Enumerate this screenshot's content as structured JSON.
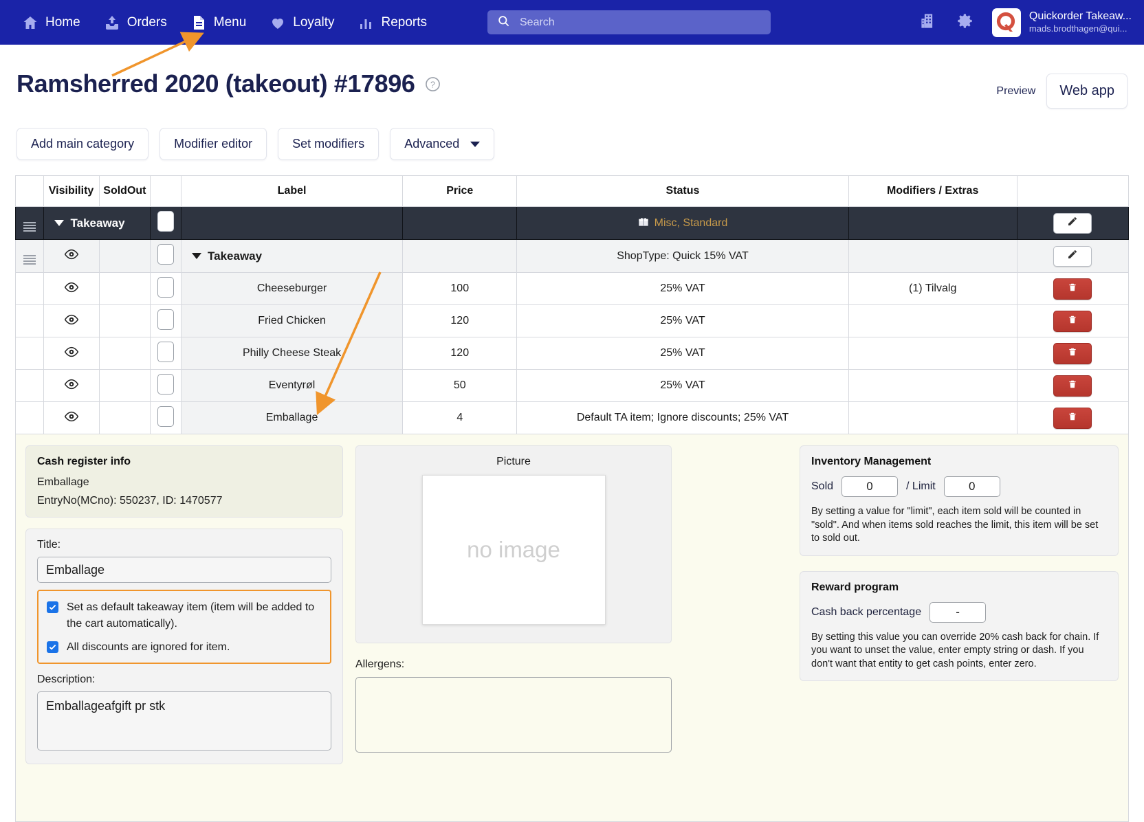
{
  "navbar": {
    "items": [
      {
        "label": "Home",
        "icon": "home-icon"
      },
      {
        "label": "Orders",
        "icon": "orders-icon"
      },
      {
        "label": "Menu",
        "icon": "menu-document-icon"
      },
      {
        "label": "Loyalty",
        "icon": "heart-icon"
      },
      {
        "label": "Reports",
        "icon": "bar-chart-icon"
      }
    ],
    "search": {
      "placeholder": "Search",
      "value": ""
    },
    "building_icon": "building-icon",
    "gear_icon": "gear-icon",
    "brand": {
      "logo_letter": "Q",
      "name": "Quickorder Takeaw...",
      "email": "mads.brodthagen@qui..."
    }
  },
  "header": {
    "title": "Ramsherred 2020 (takeout) #17896",
    "help_icon": "help-circle-icon",
    "preview_label": "Preview",
    "webapp_button": "Web app"
  },
  "toolbar": {
    "add_main_category": "Add main category",
    "modifier_editor": "Modifier editor",
    "set_modifiers": "Set modifiers",
    "advanced": "Advanced"
  },
  "table": {
    "columns": [
      "",
      "Visibility",
      "SoldOut",
      "",
      "Label",
      "Price",
      "Status",
      "Modifiers / Extras",
      ""
    ],
    "category_row": {
      "name": "Takeaway",
      "status": "Misc, Standard",
      "status_icon": "gift-icon",
      "action_icon": "pencil-icon"
    },
    "sub_row": {
      "name": "Takeaway",
      "status": "ShopType: Quick 15% VAT",
      "action_icon": "pencil-icon"
    },
    "items": [
      {
        "label": "Cheeseburger",
        "price": "100",
        "status": "25% VAT",
        "modifiers": "(1) Tilvalg"
      },
      {
        "label": "Fried Chicken",
        "price": "120",
        "status": "25% VAT",
        "modifiers": ""
      },
      {
        "label": "Philly Cheese Steak",
        "price": "120",
        "status": "25% VAT",
        "modifiers": ""
      },
      {
        "label": "Eventyrøl",
        "price": "50",
        "status": "25% VAT",
        "modifiers": ""
      },
      {
        "label": "Emballage",
        "price": "4",
        "status": "Default TA item; Ignore discounts; 25% VAT",
        "modifiers": ""
      }
    ],
    "delete_icon": "trash-icon"
  },
  "detail": {
    "cash_register": {
      "title": "Cash register info",
      "name": "Emballage",
      "entry": "EntryNo(MCno): 550237, ID: 1470577"
    },
    "title_field": {
      "label": "Title:",
      "value": "Emballage"
    },
    "checkboxes": [
      {
        "label": "Set as default takeaway item (item will be added to the cart automatically).",
        "checked": true
      },
      {
        "label": "All discounts are ignored for item.",
        "checked": true
      }
    ],
    "description_field": {
      "label": "Description:",
      "value": "Emballageafgift pr stk"
    },
    "picture": {
      "title": "Picture",
      "placeholder": "no image"
    },
    "allergens": {
      "label": "Allergens:",
      "value": ""
    },
    "inventory": {
      "title": "Inventory Management",
      "sold_label": "Sold",
      "sold_value": "0",
      "limit_label": "/ Limit",
      "limit_value": "0",
      "note": "By setting a value for \"limit\", each item sold will be counted in \"sold\". And when items sold reaches the limit, this item will be set to sold out."
    },
    "reward": {
      "title": "Reward program",
      "cashback_label": "Cash back percentage",
      "cashback_value": "-",
      "note": "By setting this value you can override 20% cash back for chain. If you want to unset the value, enter empty string or dash. If you don't want that entity to get cash points, enter zero."
    }
  },
  "colors": {
    "nav_blue": "#1a23a8",
    "accent_orange": "#f0952c",
    "panel_cream": "#fbfbee",
    "dark_row": "#2e3440",
    "misc_gold": "#c79a4a",
    "delete_red": "#c9453c"
  }
}
